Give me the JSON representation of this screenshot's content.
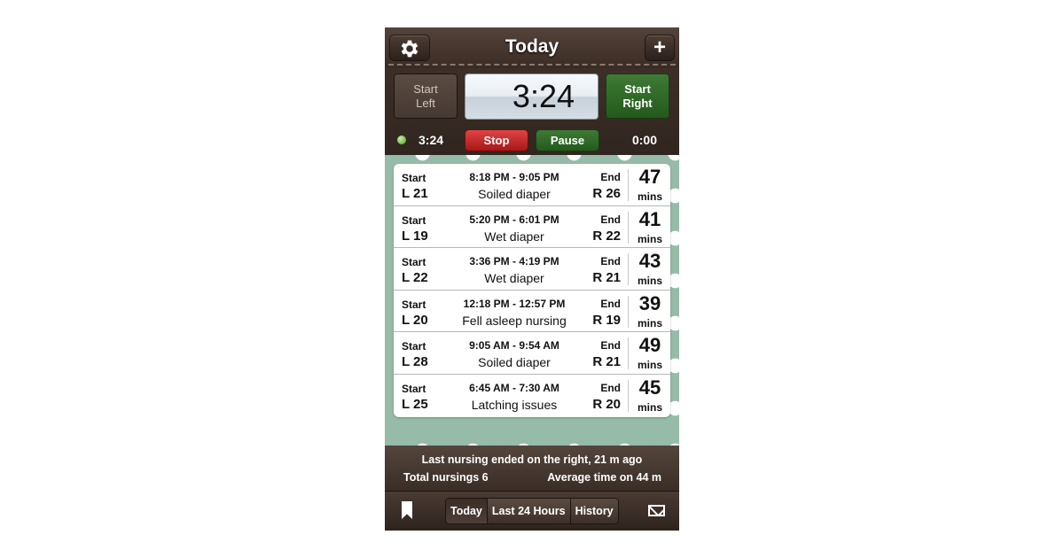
{
  "header": {
    "title": "Today",
    "settings_icon": "gear-icon",
    "add_icon": "plus-icon",
    "add_glyph": "+"
  },
  "timer": {
    "start_left": [
      "Start",
      "Left"
    ],
    "display": "3:24",
    "start_right": [
      "Start",
      "Right"
    ],
    "left_elapsed": "3:24",
    "stop_label": "Stop",
    "pause_label": "Pause",
    "right_elapsed": "0:00",
    "active_indicator_color": "#4f9c2b"
  },
  "sessions": [
    {
      "start_label": "Start",
      "start_side": "L 21",
      "time_range": "8:18 PM - 9:05 PM",
      "note": "Soiled diaper",
      "end_label": "End",
      "end_side": "R 26",
      "duration": "47",
      "duration_unit": "mins"
    },
    {
      "start_label": "Start",
      "start_side": "L 19",
      "time_range": "5:20 PM - 6:01 PM",
      "note": "Wet diaper",
      "end_label": "End",
      "end_side": "R 22",
      "duration": "41",
      "duration_unit": "mins"
    },
    {
      "start_label": "Start",
      "start_side": "L 22",
      "time_range": "3:36 PM - 4:19 PM",
      "note": "Wet diaper",
      "end_label": "End",
      "end_side": "R 21",
      "duration": "43",
      "duration_unit": "mins"
    },
    {
      "start_label": "Start",
      "start_side": "L 20",
      "time_range": "12:18 PM - 12:57 PM",
      "note": "Fell asleep nursing",
      "end_label": "End",
      "end_side": "R 19",
      "duration": "39",
      "duration_unit": "mins"
    },
    {
      "start_label": "Start",
      "start_side": "L 28",
      "time_range": "9:05 AM - 9:54 AM",
      "note": "Soiled diaper",
      "end_label": "End",
      "end_side": "R 21",
      "duration": "49",
      "duration_unit": "mins"
    },
    {
      "start_label": "Start",
      "start_side": "L 25",
      "time_range": "6:45 AM - 7:30 AM",
      "note": "Latching issues",
      "end_label": "End",
      "end_side": "R 20",
      "duration": "45",
      "duration_unit": "mins"
    }
  ],
  "summary": {
    "last_nursing": "Last nursing ended on the right, 21 m ago",
    "total": "Total nursings 6",
    "average": "Average time on 44 m"
  },
  "tabbar": {
    "bookmark_icon": "bookmark-icon",
    "tabs": [
      "Today",
      "Last 24 Hours",
      "History"
    ],
    "active_tab": "Today",
    "mail_icon": "mail-icon"
  },
  "colors": {
    "leather": "#3d2f27",
    "list_background": "#97bba9",
    "stop_red": "#c42a2a",
    "start_green": "#2f6a27"
  }
}
